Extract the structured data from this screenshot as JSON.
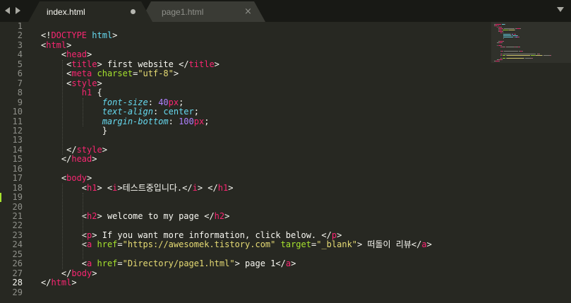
{
  "tabs": [
    {
      "label": "index.html",
      "active": true,
      "dirty": true
    },
    {
      "label": "page1.html",
      "active": false,
      "dirty": false
    }
  ],
  "tab_close_glyph": "×",
  "current_line": 28,
  "modified_line": 19,
  "colors": {
    "background": "#272822",
    "tabbar": "#181915",
    "tag": "#f92672",
    "attribute": "#a6e22e",
    "string": "#e6db74",
    "css_property": "#66d9ef",
    "number": "#ae81ff",
    "text": "#f8f8f2",
    "line_number": "#8f908a",
    "modified_marker": "#a6e22e"
  },
  "code_lines": [
    {
      "n": 1,
      "tokens": []
    },
    {
      "n": 2,
      "tokens": [
        [
          "punct",
          "<!"
        ],
        [
          "doctype",
          "DOCTYPE"
        ],
        [
          "punct",
          " "
        ],
        [
          "doctypekw",
          "html"
        ],
        [
          "punct",
          ">"
        ]
      ]
    },
    {
      "n": 3,
      "tokens": [
        [
          "punct",
          "<"
        ],
        [
          "tag",
          "html"
        ],
        [
          "punct",
          ">"
        ]
      ]
    },
    {
      "n": 4,
      "tokens": [
        [
          "punct",
          "    <"
        ],
        [
          "tag",
          "head"
        ],
        [
          "punct",
          ">"
        ]
      ]
    },
    {
      "n": 5,
      "tokens": [
        [
          "punct",
          "     <"
        ],
        [
          "tag",
          "title"
        ],
        [
          "punct",
          "> "
        ],
        [
          "text",
          "first website "
        ],
        [
          "punct",
          "</"
        ],
        [
          "tag",
          "title"
        ],
        [
          "punct",
          ">"
        ]
      ]
    },
    {
      "n": 6,
      "tokens": [
        [
          "punct",
          "     <"
        ],
        [
          "tag",
          "meta"
        ],
        [
          "punct",
          " "
        ],
        [
          "attr",
          "charset"
        ],
        [
          "punct",
          "="
        ],
        [
          "str",
          "\"utf-8\""
        ],
        [
          "punct",
          ">"
        ]
      ]
    },
    {
      "n": 7,
      "tokens": [
        [
          "punct",
          "     <"
        ],
        [
          "tag",
          "style"
        ],
        [
          "punct",
          ">"
        ]
      ]
    },
    {
      "n": 8,
      "tokens": [
        [
          "text",
          "        "
        ],
        [
          "sel",
          "h1"
        ],
        [
          "punct",
          " {"
        ]
      ]
    },
    {
      "n": 9,
      "tokens": [
        [
          "text",
          "            "
        ],
        [
          "prop",
          "font-size"
        ],
        [
          "punct",
          ": "
        ],
        [
          "num",
          "40"
        ],
        [
          "unit",
          "px"
        ],
        [
          "punct",
          ";"
        ]
      ]
    },
    {
      "n": 10,
      "tokens": [
        [
          "text",
          "            "
        ],
        [
          "prop",
          "text-align"
        ],
        [
          "punct",
          ": "
        ],
        [
          "const",
          "center"
        ],
        [
          "punct",
          ";"
        ]
      ]
    },
    {
      "n": 11,
      "tokens": [
        [
          "text",
          "            "
        ],
        [
          "prop",
          "margin-bottom"
        ],
        [
          "punct",
          ": "
        ],
        [
          "num",
          "100"
        ],
        [
          "unit",
          "px"
        ],
        [
          "punct",
          ";"
        ]
      ]
    },
    {
      "n": 12,
      "tokens": [
        [
          "text",
          "            "
        ],
        [
          "punct",
          "}"
        ]
      ]
    },
    {
      "n": 13,
      "tokens": []
    },
    {
      "n": 14,
      "tokens": [
        [
          "punct",
          "     </"
        ],
        [
          "tag",
          "style"
        ],
        [
          "punct",
          ">"
        ]
      ]
    },
    {
      "n": 15,
      "tokens": [
        [
          "punct",
          "    </"
        ],
        [
          "tag",
          "head"
        ],
        [
          "punct",
          ">"
        ]
      ]
    },
    {
      "n": 16,
      "tokens": []
    },
    {
      "n": 17,
      "tokens": [
        [
          "punct",
          "    <"
        ],
        [
          "tag",
          "body"
        ],
        [
          "punct",
          ">"
        ]
      ]
    },
    {
      "n": 18,
      "tokens": [
        [
          "punct",
          "        <"
        ],
        [
          "tag",
          "h1"
        ],
        [
          "punct",
          "> <"
        ],
        [
          "tag",
          "i"
        ],
        [
          "punct",
          ">"
        ],
        [
          "text",
          "테스트중입니다."
        ],
        [
          "punct",
          "</"
        ],
        [
          "tag",
          "i"
        ],
        [
          "punct",
          "> </"
        ],
        [
          "tag",
          "h1"
        ],
        [
          "punct",
          ">"
        ]
      ]
    },
    {
      "n": 19,
      "tokens": []
    },
    {
      "n": 20,
      "tokens": []
    },
    {
      "n": 21,
      "tokens": [
        [
          "punct",
          "        <"
        ],
        [
          "tag",
          "h2"
        ],
        [
          "punct",
          "> "
        ],
        [
          "text",
          "welcome to my page "
        ],
        [
          "punct",
          "</"
        ],
        [
          "tag",
          "h2"
        ],
        [
          "punct",
          ">"
        ]
      ]
    },
    {
      "n": 22,
      "tokens": []
    },
    {
      "n": 23,
      "tokens": [
        [
          "punct",
          "        <"
        ],
        [
          "tag",
          "p"
        ],
        [
          "punct",
          "> "
        ],
        [
          "text",
          "If you want more information, click below. "
        ],
        [
          "punct",
          "</"
        ],
        [
          "tag",
          "p"
        ],
        [
          "punct",
          ">"
        ]
      ]
    },
    {
      "n": 24,
      "tokens": [
        [
          "punct",
          "        <"
        ],
        [
          "tag",
          "a"
        ],
        [
          "punct",
          " "
        ],
        [
          "attr",
          "href"
        ],
        [
          "punct",
          "="
        ],
        [
          "str",
          "\"https://awesomek.tistory.com\""
        ],
        [
          "punct",
          " "
        ],
        [
          "attr",
          "target"
        ],
        [
          "punct",
          "="
        ],
        [
          "str",
          "\"_blank\""
        ],
        [
          "punct",
          "> "
        ],
        [
          "text",
          "떠돌이 리뷰"
        ],
        [
          "punct",
          "</"
        ],
        [
          "tag",
          "a"
        ],
        [
          "punct",
          ">"
        ]
      ]
    },
    {
      "n": 25,
      "tokens": []
    },
    {
      "n": 26,
      "tokens": [
        [
          "punct",
          "        <"
        ],
        [
          "tag",
          "a"
        ],
        [
          "punct",
          " "
        ],
        [
          "attr",
          "href"
        ],
        [
          "punct",
          "="
        ],
        [
          "str",
          "\"Directory/page1.html\""
        ],
        [
          "punct",
          "> "
        ],
        [
          "text",
          "page 1"
        ],
        [
          "punct",
          "</"
        ],
        [
          "tag",
          "a"
        ],
        [
          "punct",
          ">"
        ]
      ]
    },
    {
      "n": 27,
      "tokens": [
        [
          "punct",
          "    </"
        ],
        [
          "tag",
          "body"
        ],
        [
          "punct",
          ">"
        ]
      ]
    },
    {
      "n": 28,
      "tokens": [
        [
          "punct",
          "</"
        ],
        [
          "tag",
          "html"
        ],
        [
          "punct",
          ">"
        ]
      ]
    },
    {
      "n": 29,
      "tokens": []
    }
  ]
}
